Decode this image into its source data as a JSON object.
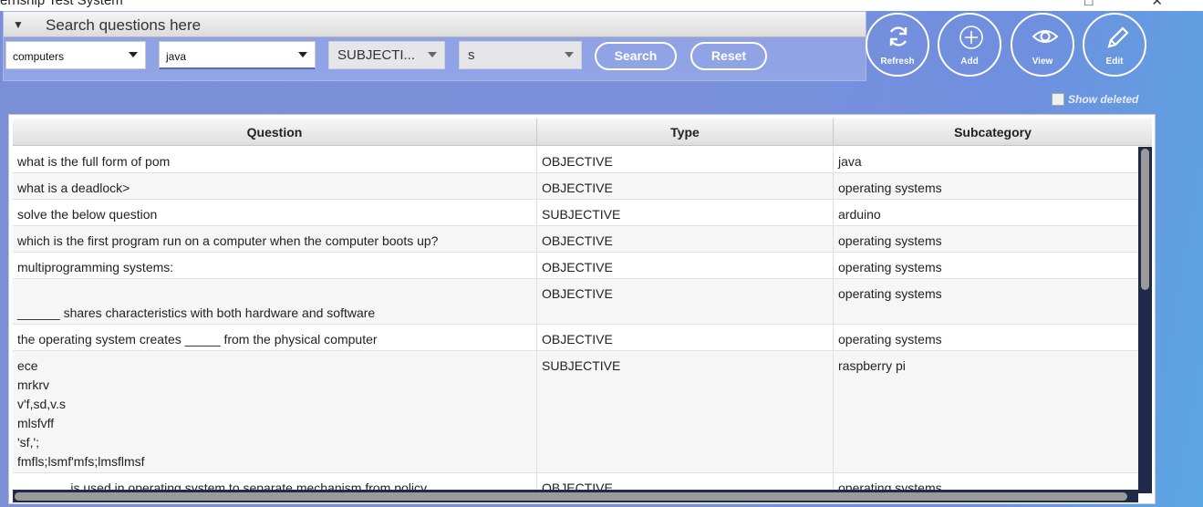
{
  "window": {
    "title": "ernship Test System",
    "controls": "□ ✕"
  },
  "search": {
    "header_label": "Search questions here",
    "category": "computers",
    "subcategory": "java",
    "type": "SUBJECTI...",
    "term": "s",
    "search_label": "Search",
    "reset_label": "Reset"
  },
  "actions": [
    {
      "label": "Refresh",
      "icon": "refresh-icon"
    },
    {
      "label": "Add",
      "icon": "add-icon"
    },
    {
      "label": "View",
      "icon": "eye-icon"
    },
    {
      "label": "Edit",
      "icon": "pencil-icon"
    }
  ],
  "show_deleted_label": "Show deleted",
  "table": {
    "columns": [
      "Question",
      "Type",
      "Subcategory"
    ],
    "rows": [
      {
        "question": "what is the full form of pom",
        "type": "OBJECTIVE",
        "subcategory": "java"
      },
      {
        "question": "what is a deadlock>",
        "type": "OBJECTIVE",
        "subcategory": "operating systems"
      },
      {
        "question": "solve the below question",
        "type": "SUBJECTIVE",
        "subcategory": "arduino"
      },
      {
        "question": "which is the first program run on a computer when the computer boots up?",
        "type": "OBJECTIVE",
        "subcategory": "operating systems"
      },
      {
        "question": "multiprogramming systems:",
        "type": "OBJECTIVE",
        "subcategory": "operating systems"
      },
      {
        "question": "\n______ shares characteristics with both hardware and software",
        "type": "OBJECTIVE",
        "subcategory": "operating systems"
      },
      {
        "question": "the operating system creates _____ from the physical computer",
        "type": "OBJECTIVE",
        "subcategory": "operating systems"
      },
      {
        "question": "ece\nmrkrv\nv'f,sd,v.s\nmlsfvff\n'sf,';\nfmfls;lsmf'mfs;lmsflmsf",
        "type": "SUBJECTIVE",
        "subcategory": "raspberry pi"
      },
      {
        "question": "_______ is used in operating system to separate mechanism from policy",
        "type": "OBJECTIVE",
        "subcategory": "operating systems"
      }
    ]
  }
}
